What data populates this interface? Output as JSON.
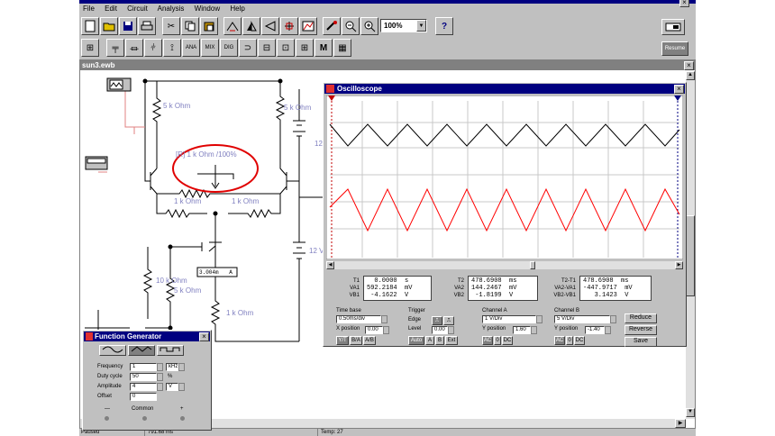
{
  "menu": [
    "File",
    "Edit",
    "Circuit",
    "Analysis",
    "Window",
    "Help"
  ],
  "toolbar": {
    "zoom": "100%",
    "zoom_arrow": "▼",
    "help": "?",
    "reduce_right": "Resume",
    "icon_m": "M"
  },
  "circuit_window": {
    "title": "sun3.ewb"
  },
  "circuit": {
    "r_top_left": "5 k Ohm",
    "r_top_right": "5 k Ohm",
    "pot": "[R] 1 k Ohm /100%",
    "r_mid_left": "1 k Ohm",
    "r_mid_right": "1 k Ohm",
    "v_top": "12",
    "v_bottom": "12 V",
    "ammeter_value": "3.004m",
    "ammeter_unit": "A",
    "r_bottom_left": "10 k Ohm",
    "r_bottom_mid": "5 k Ohm",
    "r_bottom": "1 k Ohm"
  },
  "oscilloscope": {
    "title": "Oscilloscope",
    "readouts": {
      "t1_label": "T1",
      "va1_label": "VA1",
      "vb1_label": "VB1",
      "t1": "  0.0000  s\n592.2184  mV\n -4.1622  V",
      "t2_label": "T2",
      "va2_label": "VA2",
      "vb2_label": "VB2",
      "t2": "478.6908  ms\n144.2467  mV\n -1.8199  V",
      "t2t1_label": "T2-T1",
      "va2va1_label": "VA2-VA1",
      "vb2vb1_label": "VB2-VB1",
      "t2t1": "478.6908  ms\n-447.9717  mV\n   3.1423  V"
    },
    "time_base": {
      "label": "Time base",
      "value": "0.50ms/div",
      "x_pos_label": "X position",
      "x_pos": "0.00",
      "btn1": "Y/T",
      "btn2": "B/A",
      "btn3": "A/B"
    },
    "trigger": {
      "label": "Trigger",
      "edge_label": "Edge",
      "level_label": "Level",
      "level": "0.00",
      "btn_auto": "Auto",
      "btn_a": "A",
      "btn_b": "B",
      "btn_ext": "Ext"
    },
    "channel_a": {
      "label": "Channel A",
      "value": "1 V/Div",
      "ypos_label": "Y position",
      "ypos": "1.60",
      "ac": "AC",
      "zero": "0",
      "dc": "DC"
    },
    "channel_b": {
      "label": "Channel B",
      "value": "5 V/Div",
      "ypos_label": "Y position",
      "ypos": "-1.40",
      "ac": "AC",
      "zero": "0",
      "dc": "DC"
    },
    "buttons": {
      "reduce": "Reduce",
      "reverse": "Reverse",
      "save": "Save"
    }
  },
  "function_generator": {
    "title": "Function Generator",
    "frequency_label": "Frequency",
    "frequency": "1",
    "frequency_unit": "kHz",
    "duty_label": "Duty cycle",
    "duty": "50",
    "duty_unit": "%",
    "amplitude_label": "Amplitude",
    "amplitude": "4",
    "amplitude_unit": "V",
    "offset_label": "Offset",
    "offset": "0",
    "minus": "—",
    "common": "Common",
    "plus": "+"
  },
  "status": {
    "left": "Paused",
    "time": "791.68 ms",
    "temp": "Temp:  27"
  },
  "colors": {
    "titlebar": "#000080",
    "scope_bg": "#ffffff",
    "channel_a_trace": "#000000",
    "channel_b_trace": "#ff0000",
    "highlight_circle": "#e00000",
    "circuit_wire": "#000000",
    "label_color": "#8080c0"
  }
}
